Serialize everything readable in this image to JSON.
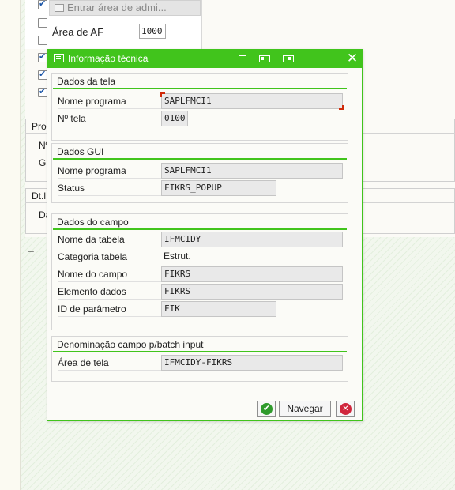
{
  "background": {
    "entrar_button": "Entrar área de admi...",
    "area_af_label": "Área de AF",
    "area_af_value": "1000",
    "checkboxes": [
      true,
      false,
      false,
      true,
      true,
      true
    ],
    "fragments": {
      "proc": "Proc",
      "no": "Nº",
      "gr": "Gr",
      "dt": "Dt.l",
      "da": "Da",
      "dash": "_"
    }
  },
  "dialog": {
    "title": "Informação técnica",
    "groups": {
      "dados_tela": {
        "title": "Dados da tela",
        "nome_programa_label": "Nome programa",
        "nome_programa_value": "SAPLFMCI1",
        "no_tela_label": "Nº tela",
        "no_tela_value": "0100"
      },
      "dados_gui": {
        "title": "Dados GUI",
        "nome_programa_label": "Nome programa",
        "nome_programa_value": "SAPLFMCI1",
        "status_label": "Status",
        "status_value": "FIKRS_POPUP"
      },
      "dados_campo": {
        "title": "Dados do campo",
        "nome_tabela_label": "Nome da tabela",
        "nome_tabela_value": "IFMCIDY",
        "categoria_label": "Categoria tabela",
        "categoria_value": "Estrut.",
        "nome_campo_label": "Nome do campo",
        "nome_campo_value": "FIKRS",
        "elemento_label": "Elemento dados",
        "elemento_value": "FIKRS",
        "parametro_label": "ID de parâmetro",
        "parametro_value": "FIK"
      },
      "batch": {
        "title": "Denominação campo p/batch input",
        "area_label": "Área de tela",
        "area_value": "IFMCIDY-FIKRS"
      }
    },
    "buttons": {
      "ok_icon": "check-circle-icon",
      "navegar": "Navegar",
      "cancel_icon": "cancel-circle-icon"
    },
    "colors": {
      "title_bar": "#41c41c",
      "group_rule": "#41c41c",
      "ok": "#2f9a2b",
      "cancel": "#d0263c",
      "focus_marker": "#d02a0a"
    }
  }
}
